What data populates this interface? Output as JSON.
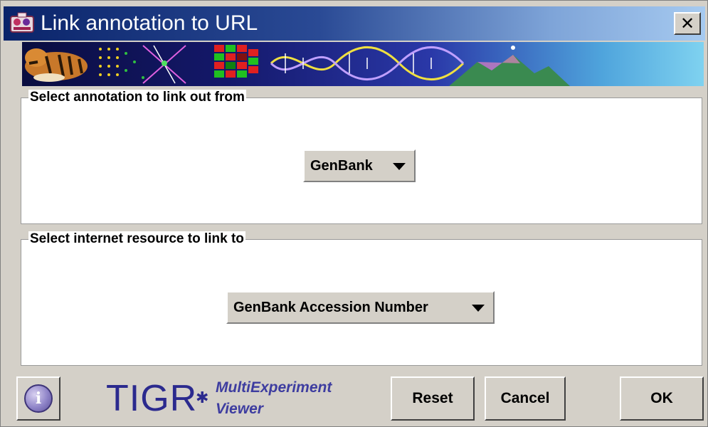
{
  "window": {
    "title": "Link annotation to URL",
    "close_label": "✕"
  },
  "group_annotation": {
    "legend": "Select annotation to link out from",
    "selected_value": "GenBank"
  },
  "group_resource": {
    "legend": "Select internet resource to link to",
    "selected_value": "GenBank Accession Number"
  },
  "footer": {
    "logo_main": "TIGR",
    "logo_star": "✱",
    "logo_sub_1": "MultiExperiment",
    "logo_sub_2": "Viewer",
    "info_label": "i",
    "reset_label": "Reset",
    "cancel_label": "Cancel",
    "ok_label": "OK"
  },
  "colors": {
    "titlebar_start": "#0a246a",
    "titlebar_end": "#a6caf0",
    "dialog_bg": "#d4d0c8",
    "logo_blue": "#2b2a8e"
  },
  "icons": {
    "title": "app-icon",
    "close": "close-icon",
    "info": "info-icon",
    "combo_arrow": "chevron-down-icon"
  }
}
